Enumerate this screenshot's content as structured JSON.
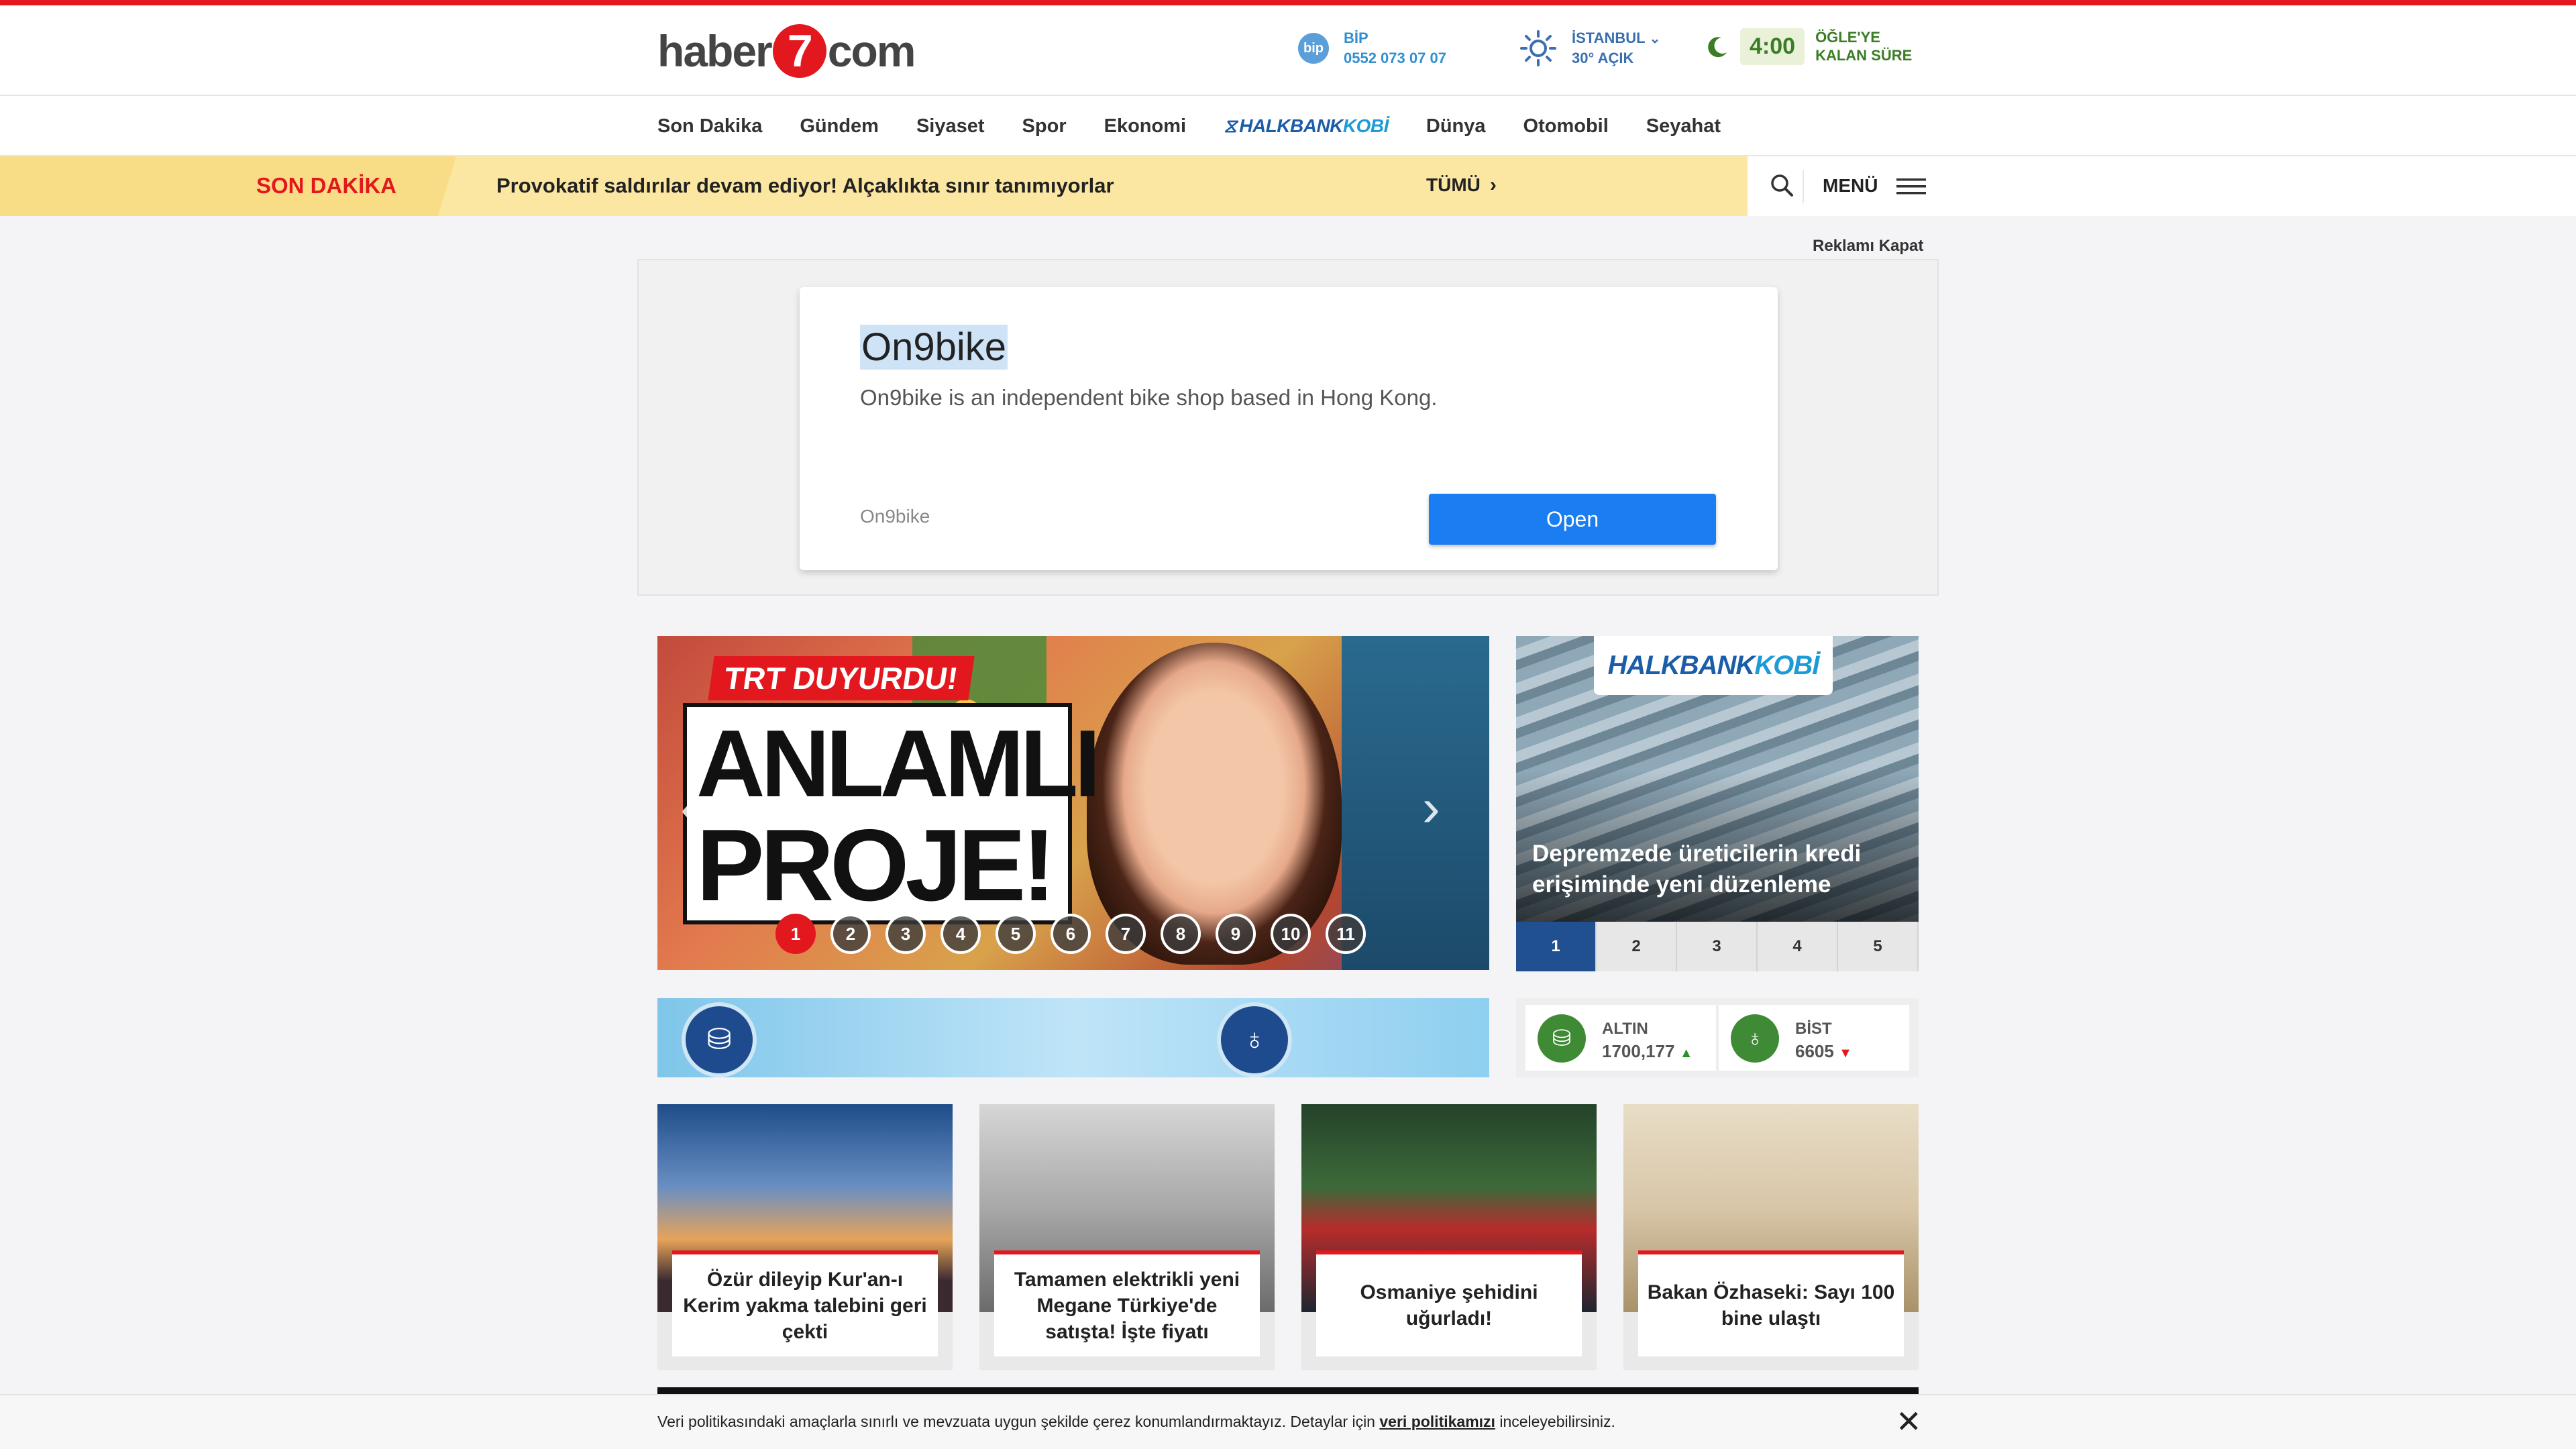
{
  "header": {
    "logo_left": "haber",
    "logo_seven": "7",
    "logo_right": "com",
    "bip": {
      "name": "BİP",
      "phone": "0552 073 07 07",
      "icon": "bip-icon"
    },
    "weather": {
      "city": "İSTANBUL",
      "temp": "30° AÇIK",
      "icon": "sun-icon"
    },
    "prayer": {
      "time": "4:00",
      "label_line1": "ÖĞLE'YE",
      "label_line2": "KALAN SÜRE",
      "icon": "crescent-moon-icon"
    }
  },
  "nav": {
    "items": [
      "Son Dakika",
      "Gündem",
      "Siyaset",
      "Spor",
      "Ekonomi"
    ],
    "sponsor_main": "HALKBANK",
    "sponsor_sub": "KOBİ",
    "items2": [
      "Dünya",
      "Otomobil",
      "Seyahat"
    ]
  },
  "breaking": {
    "label": "SON DAKİKA",
    "headline": "Provokatif saldırılar devam ediyor! Alçaklıkta sınır tanımıyorlar",
    "all_label": "TÜMÜ",
    "menu_label": "MENÜ"
  },
  "ad": {
    "close_label": "Reklamı Kapat",
    "title": "On9bike",
    "description": "On9bike is an independent bike shop based in Hong Kong.",
    "source": "On9bike",
    "button": "Open"
  },
  "slider": {
    "tag": "TRT DUYURDU!",
    "line1": "ANLAMLI",
    "line2": "PROJE!",
    "pages": [
      "1",
      "2",
      "3",
      "4",
      "5",
      "6",
      "7",
      "8",
      "9",
      "10",
      "11"
    ],
    "active_page": 1
  },
  "halkbank": {
    "logo_main": "HALKBANK",
    "logo_sub": "KOBİ",
    "caption": "Depremzede üreticilerin kredi erişiminde yeni düzenleme",
    "tabs": [
      "1",
      "2",
      "3",
      "4",
      "5"
    ],
    "active_tab": 1
  },
  "markets": [
    {
      "name": "ALTIN",
      "value": "1700,177",
      "trend": "up",
      "icon": "gold-coins-icon"
    },
    {
      "name": "BİST",
      "value": "6605",
      "trend": "down",
      "icon": "bist-flame-icon"
    }
  ],
  "news": [
    {
      "title": "Özür dileyip Kur'an-ı Kerim yakma talebini geri çekti"
    },
    {
      "title": "Tamamen elektrikli yeni Megane Türkiye'de satışta! İşte fiyatı"
    },
    {
      "title": "Osmaniye şehidini uğurladı!"
    },
    {
      "title": "Bakan Özhaseki: Sayı 100 bine ulaştı"
    }
  ],
  "cookie": {
    "text_before": "Veri politikasındaki amaçlarla sınırlı ve mevzuata uygun şekilde çerez konumlandırmaktayız. Detaylar için ",
    "link": "veri politikamızı",
    "text_after": " inceleyebilirsiniz."
  },
  "colors": {
    "accent": "#e3181e",
    "halkbank": "#1c5da8",
    "prayer_green": "#3a7d24"
  }
}
